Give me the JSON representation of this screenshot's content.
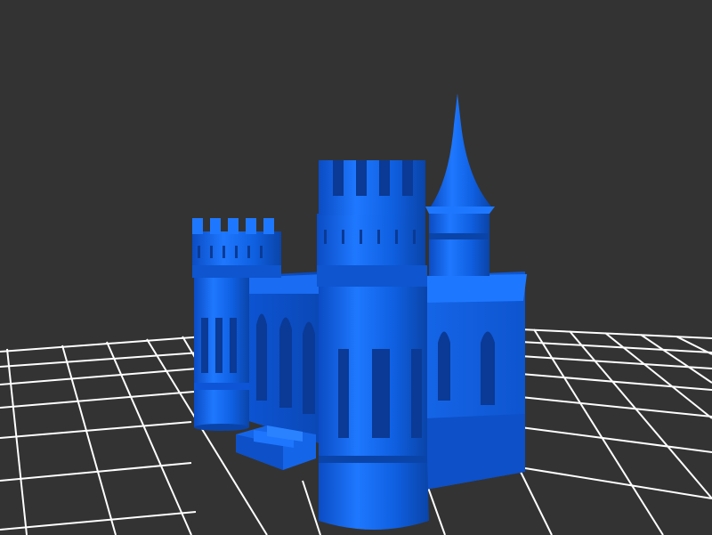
{
  "scene": {
    "background_color": "#333333",
    "grid_color": "#ffffff",
    "model_color": "#1166ee",
    "model_shadow_color": "#0a44a8",
    "model_highlight_color": "#3a8bff",
    "subject": "castle-3d-model"
  }
}
